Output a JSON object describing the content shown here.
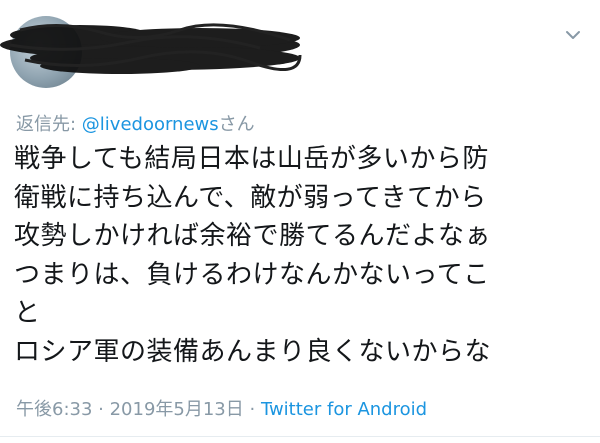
{
  "tweet": {
    "reply_prefix": "返信先: ",
    "reply_handle": "@livedoornews",
    "reply_suffix": "さん",
    "lines": [
      "戦争しても結局日本は山岳が多いから防",
      "衛戦に持ち込んで、敵が弱ってきてから",
      "攻勢しかければ余裕で勝てるんだよなぁ",
      "つまりは、負けるわけなんかないってこ",
      "と",
      "ロシア軍の装備あんまり良くないからな"
    ],
    "time": "午後6:33",
    "date": "2019年5月13日",
    "separator": " · ",
    "source": "Twitter for Android"
  },
  "icons": {
    "menu": "chevron-down-icon",
    "avatar": "avatar"
  },
  "colors": {
    "text": "#14171a",
    "secondary": "#8899a6",
    "link": "#1b95e0"
  }
}
